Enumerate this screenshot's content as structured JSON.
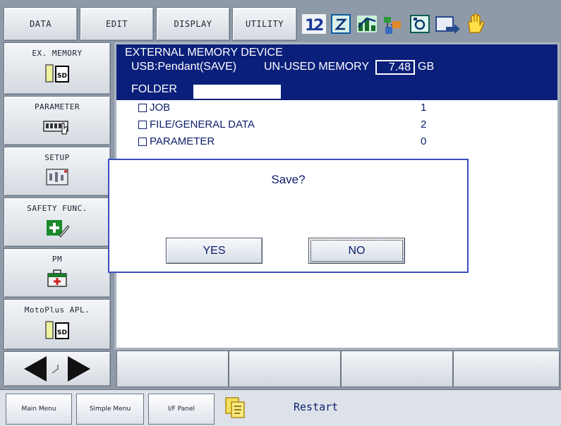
{
  "top_menu": {
    "data": "DATA",
    "edit": "EDIT",
    "display": "DISPLAY",
    "utility": "UTILITY"
  },
  "top_icons": [
    "multi-window-icon",
    "edit-window-icon",
    "chart-icon",
    "network-icon",
    "camera-icon",
    "screen-move-icon",
    "hand-icon"
  ],
  "side_menu": [
    {
      "label": "EX. MEMORY",
      "icon": "sd-card-icon"
    },
    {
      "label": "PARAMETER",
      "icon": "parameter-icon"
    },
    {
      "label": "SETUP",
      "icon": "setup-icon"
    },
    {
      "label": "SAFETY FUNC.",
      "icon": "safety-icon"
    },
    {
      "label": "PM",
      "icon": "medical-kit-icon"
    },
    {
      "label": "MotoPlus APL.",
      "icon": "sd-card-icon"
    }
  ],
  "main": {
    "title": "EXTERNAL MEMORY DEVICE",
    "device_line": "USB:Pendant(SAVE)",
    "unused_label": "UN-USED MEMORY",
    "unused_value": "7.48",
    "unused_unit": "GB",
    "folder_label": "FOLDER",
    "folder_value": "",
    "items": [
      {
        "label": "JOB",
        "count": "1"
      },
      {
        "label": "FILE/GENERAL DATA",
        "count": "2"
      },
      {
        "label": "PARAMETER",
        "count": "0"
      }
    ]
  },
  "dialog": {
    "message": "Save?",
    "yes": "YES",
    "no": "NO"
  },
  "bottom_bar": {
    "main_menu": "Main Menu",
    "simple_menu": "Simple Menu",
    "if_panel": "I/F Panel",
    "restart": "Restart"
  },
  "colors": {
    "frame": "#8f9aa8",
    "accent_blue": "#0a1f7a",
    "dialog_border": "#3a4ec0"
  }
}
